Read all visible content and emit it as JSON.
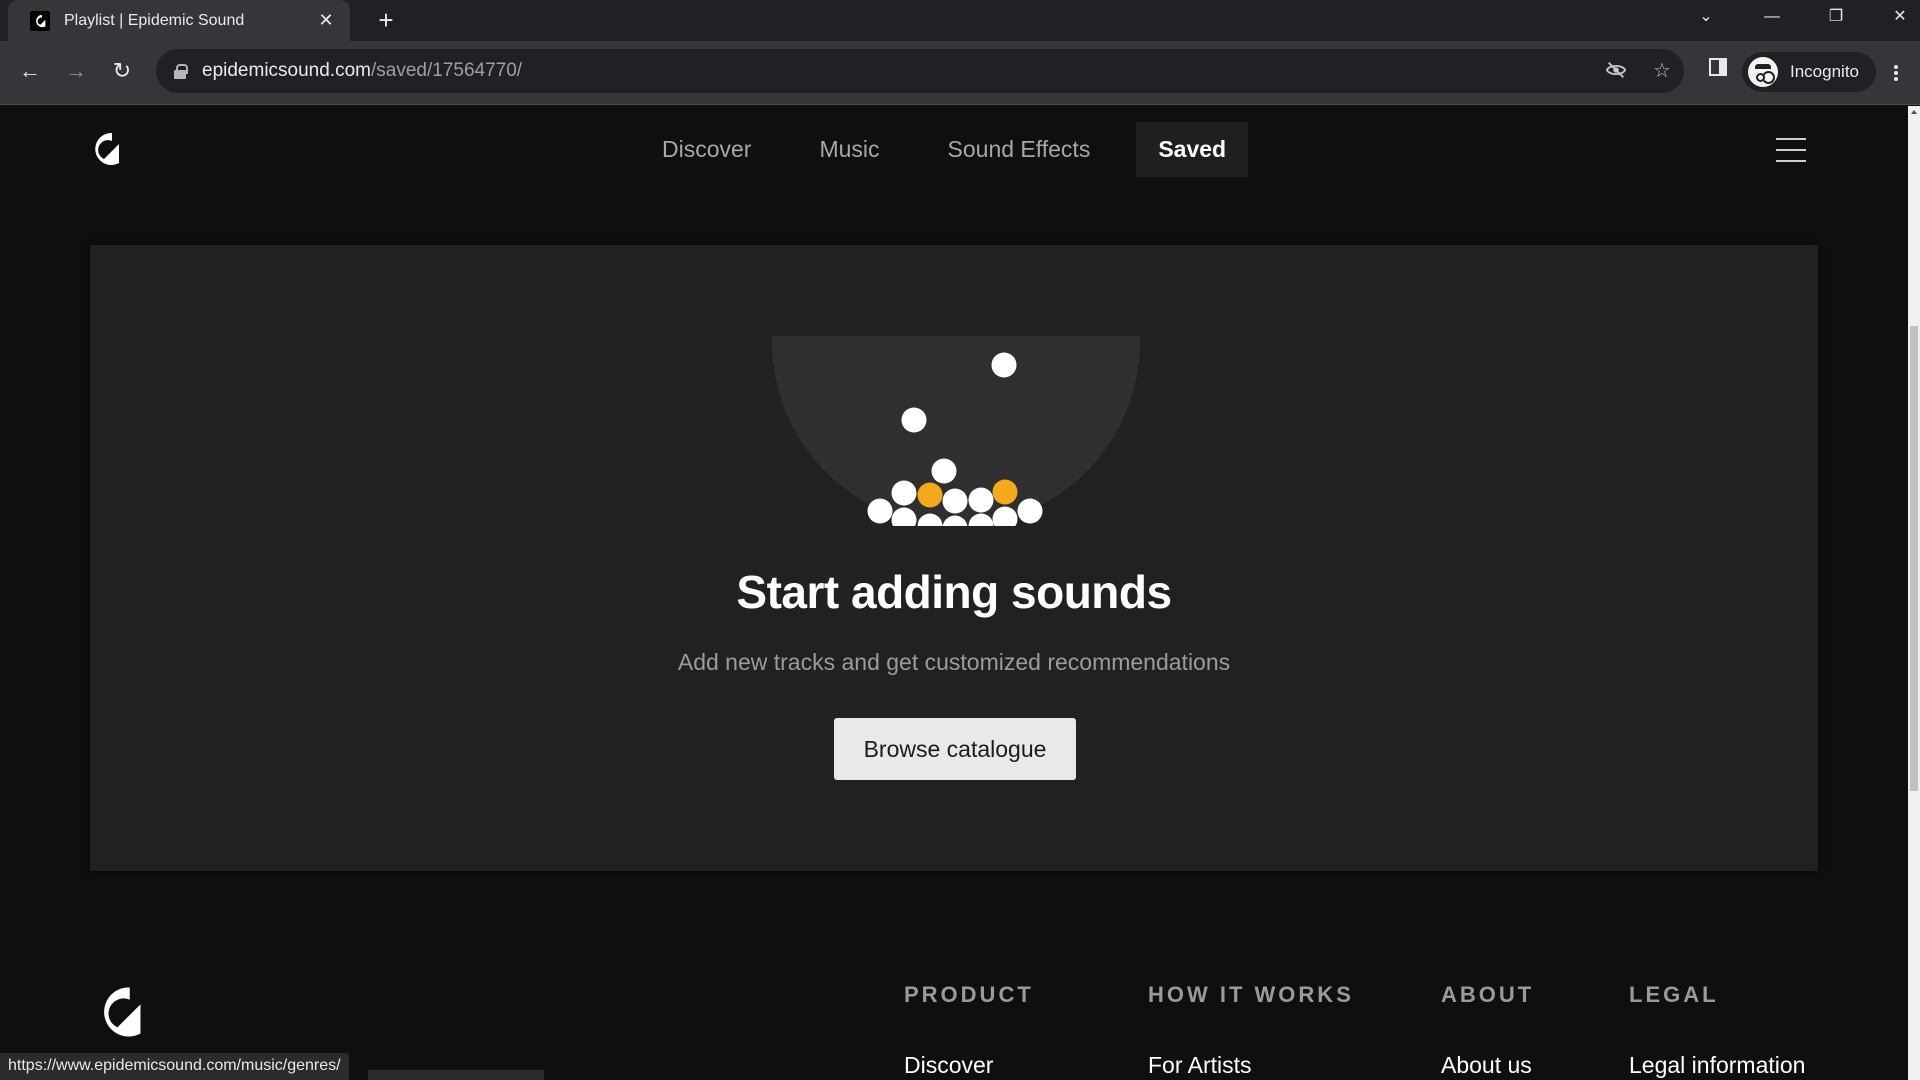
{
  "browser": {
    "tab": {
      "title": "Playlist | Epidemic Sound",
      "favicon": "epidemic-logo-icon",
      "close_icon": "close-icon"
    },
    "new_tab_icon": "plus-icon",
    "window_controls": {
      "tab_search": "chevron-down-icon",
      "minimize": "minimize-icon",
      "restore": "restore-icon",
      "close": "close-icon"
    },
    "nav": {
      "back": "arrow-left-icon",
      "forward": "arrow-right-icon",
      "reload": "reload-icon"
    },
    "address": {
      "host": "epidemicsound.com",
      "path": "/saved/17564770/",
      "lock_icon": "lock-icon"
    },
    "omnibox_icons": [
      "eye-off-icon",
      "star-icon"
    ],
    "side_panel_icon": "side-panel-icon",
    "profile": {
      "label": "Incognito",
      "icon": "incognito-icon"
    },
    "menu_icon": "kebab-menu-icon",
    "status_url": "https://www.epidemicsound.com/music/genres/"
  },
  "site": {
    "logo_icon": "epidemic-logo-icon",
    "nav": [
      {
        "label": "Discover",
        "active": false
      },
      {
        "label": "Music",
        "active": false
      },
      {
        "label": "Sound Effects",
        "active": false
      },
      {
        "label": "Saved",
        "active": true
      }
    ],
    "menu_icon": "hamburger-icon"
  },
  "empty_state": {
    "title": "Start adding sounds",
    "subtitle": "Add new tracks and get customized recommendations",
    "button_label": "Browse catalogue",
    "colors": {
      "ball": "#ffffff",
      "accent_ball": "#f4a91c",
      "bowl": "#2f2f2f"
    }
  },
  "footer": {
    "columns": [
      {
        "heading": "PRODUCT",
        "first_link": "Discover"
      },
      {
        "heading": "HOW IT WORKS",
        "first_link": "For Artists"
      },
      {
        "heading": "ABOUT",
        "first_link": "About us"
      },
      {
        "heading": "LEGAL",
        "first_link": "Legal information"
      }
    ]
  }
}
